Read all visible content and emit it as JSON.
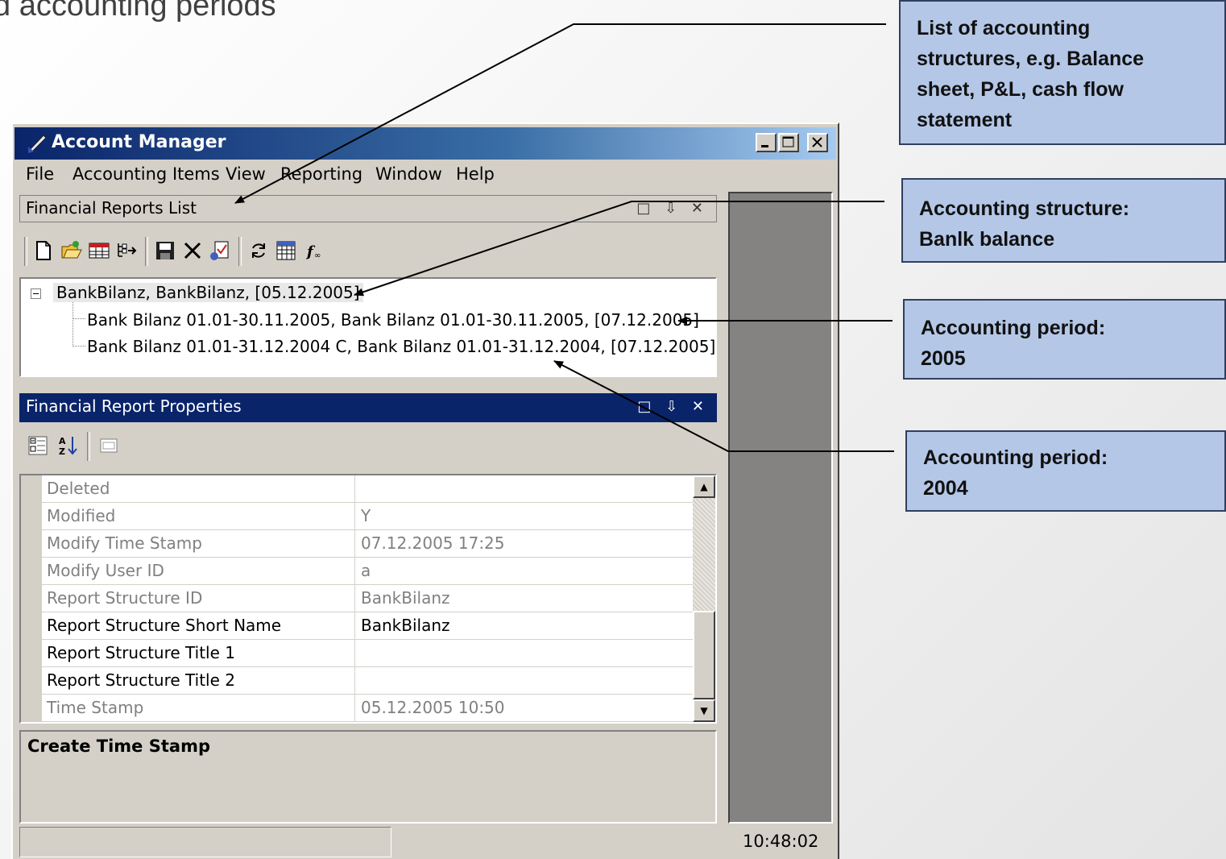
{
  "slide_title": "d accounting periods",
  "callouts": {
    "list": [
      "List of accounting",
      "structures, e.g. Balance",
      "sheet, P&L, cash flow",
      "statement"
    ],
    "structure": [
      "Accounting structure:",
      "Banlk balance"
    ],
    "period_2005": [
      "Accounting period:",
      "2005"
    ],
    "period_2004": [
      "Accounting period:",
      "2004"
    ]
  },
  "window": {
    "title": "Account Manager",
    "menu": [
      "File",
      "Accounting Items",
      "View",
      "Reporting",
      "Window",
      "Help"
    ]
  },
  "reports_panel": {
    "title": "Financial Reports List",
    "header_icons": "□ ⇩ ✕",
    "toolbar_icons": [
      "new-file-icon",
      "open-folder-icon",
      "table-icon",
      "tree-export-icon",
      "save-icon",
      "delete-icon",
      "check-doc-icon",
      "refresh-icon",
      "grid-icon",
      "function-icon"
    ]
  },
  "tree": {
    "root": "BankBilanz, BankBilanz, [05.12.2005]",
    "children": [
      "Bank Bilanz 01.01-30.11.2005, Bank Bilanz 01.01-30.11.2005, [07.12.2005]",
      "Bank Bilanz 01.01-31.12.2004 C, Bank Bilanz 01.01-31.12.2004, [07.12.2005]"
    ]
  },
  "properties_panel": {
    "title": "Financial Report Properties",
    "header_icons": "□ ⇩ ✕",
    "rows": [
      {
        "name": "Deleted",
        "value": ""
      },
      {
        "name": "Modified",
        "value": "Y"
      },
      {
        "name": "Modify Time Stamp",
        "value": "07.12.2005 17:25"
      },
      {
        "name": "Modify User ID",
        "value": "a"
      },
      {
        "name": "Report Structure ID",
        "value": "BankBilanz"
      },
      {
        "name": "Report Structure Short Name",
        "value": "BankBilanz"
      },
      {
        "name": "Report Structure Title 1",
        "value": ""
      },
      {
        "name": "Report Structure Title 2",
        "value": ""
      },
      {
        "name": "Time Stamp",
        "value": "05.12.2005 10:50"
      }
    ],
    "description_title": "Create Time Stamp"
  },
  "status": {
    "clock": "10:48:02"
  }
}
